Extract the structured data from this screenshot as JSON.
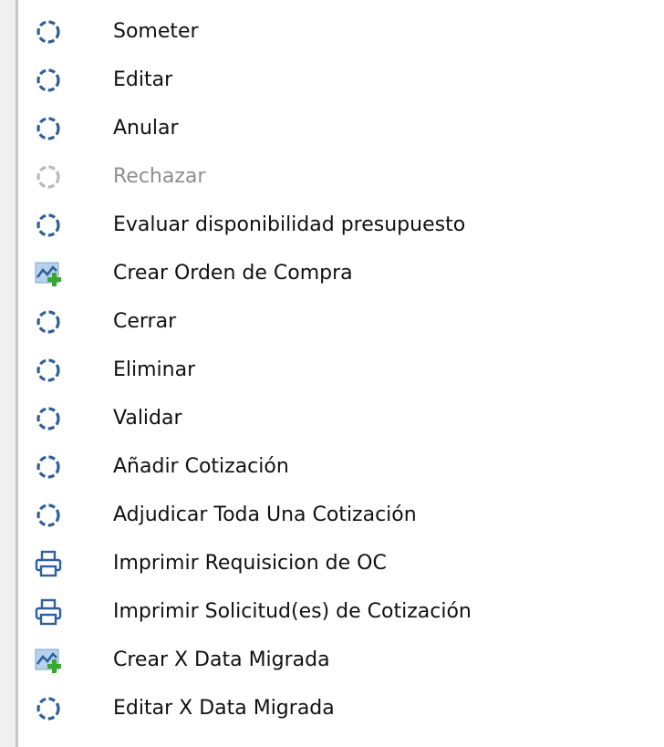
{
  "colors": {
    "icon_primary": "#2f5f9c",
    "icon_disabled": "#b9b9b9",
    "add_green": "#3aa82c",
    "text": "#111111",
    "text_disabled": "#8e8e8e"
  },
  "menu": {
    "items": [
      {
        "label": "Someter",
        "icon": "process-icon",
        "enabled": true
      },
      {
        "label": "Editar",
        "icon": "process-icon",
        "enabled": true
      },
      {
        "label": "Anular",
        "icon": "process-icon",
        "enabled": true
      },
      {
        "label": "Rechazar",
        "icon": "process-icon",
        "enabled": false
      },
      {
        "label": "Evaluar disponibilidad presupuesto",
        "icon": "process-icon",
        "enabled": true
      },
      {
        "label": "Crear Orden de Compra",
        "icon": "create-report-icon",
        "enabled": true
      },
      {
        "label": "Cerrar",
        "icon": "process-icon",
        "enabled": true
      },
      {
        "label": "Eliminar",
        "icon": "process-icon",
        "enabled": true
      },
      {
        "label": "Validar",
        "icon": "process-icon",
        "enabled": true
      },
      {
        "label": "Añadir Cotización",
        "icon": "process-icon",
        "enabled": true
      },
      {
        "label": "Adjudicar Toda Una Cotización",
        "icon": "process-icon",
        "enabled": true
      },
      {
        "label": "Imprimir Requisicion de OC",
        "icon": "print-icon",
        "enabled": true
      },
      {
        "label": "Imprimir Solicitud(es) de Cotización",
        "icon": "print-icon",
        "enabled": true
      },
      {
        "label": "Crear X Data Migrada",
        "icon": "create-report-icon",
        "enabled": true
      },
      {
        "label": "Editar X Data Migrada",
        "icon": "process-icon",
        "enabled": true
      }
    ]
  }
}
